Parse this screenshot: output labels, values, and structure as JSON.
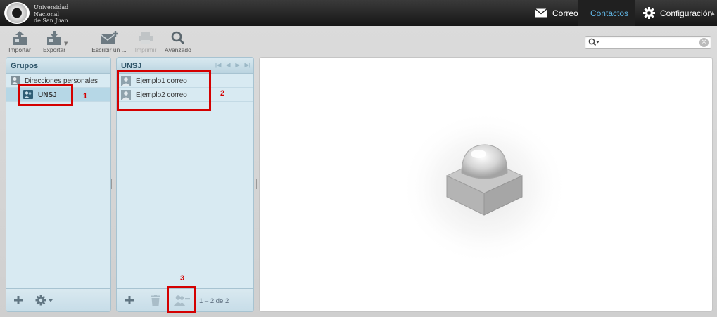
{
  "header": {
    "logo_lines": [
      "Universidad",
      "Nacional",
      "de San Juan"
    ],
    "nav": [
      {
        "label": "Correo",
        "icon": "envelope-icon"
      },
      {
        "label": "Contactos",
        "icon": "person-icon",
        "active": true
      },
      {
        "label": "Configuración",
        "icon": "gear-icon"
      }
    ]
  },
  "toolbar": {
    "import_label": "Importar",
    "export_label": "Exportar",
    "compose_label": "Escribir un ...",
    "print_label": "Imprimir",
    "advanced_label": "Avanzado",
    "search_placeholder": ""
  },
  "groups_panel": {
    "title": "Grupos",
    "address_book": "Direcciones personales",
    "groups": [
      "UNSJ"
    ]
  },
  "contacts_panel": {
    "title": "UNSJ",
    "contacts": [
      "Ejemplo1 correo",
      "Ejemplo2 correo"
    ],
    "count": "1 – 2 de 2"
  },
  "annotations": [
    "1",
    "2",
    "3"
  ],
  "colors": {
    "accent": "#5fb2e0",
    "panel_bg": "#d8eaf2",
    "callout": "#d40000"
  }
}
